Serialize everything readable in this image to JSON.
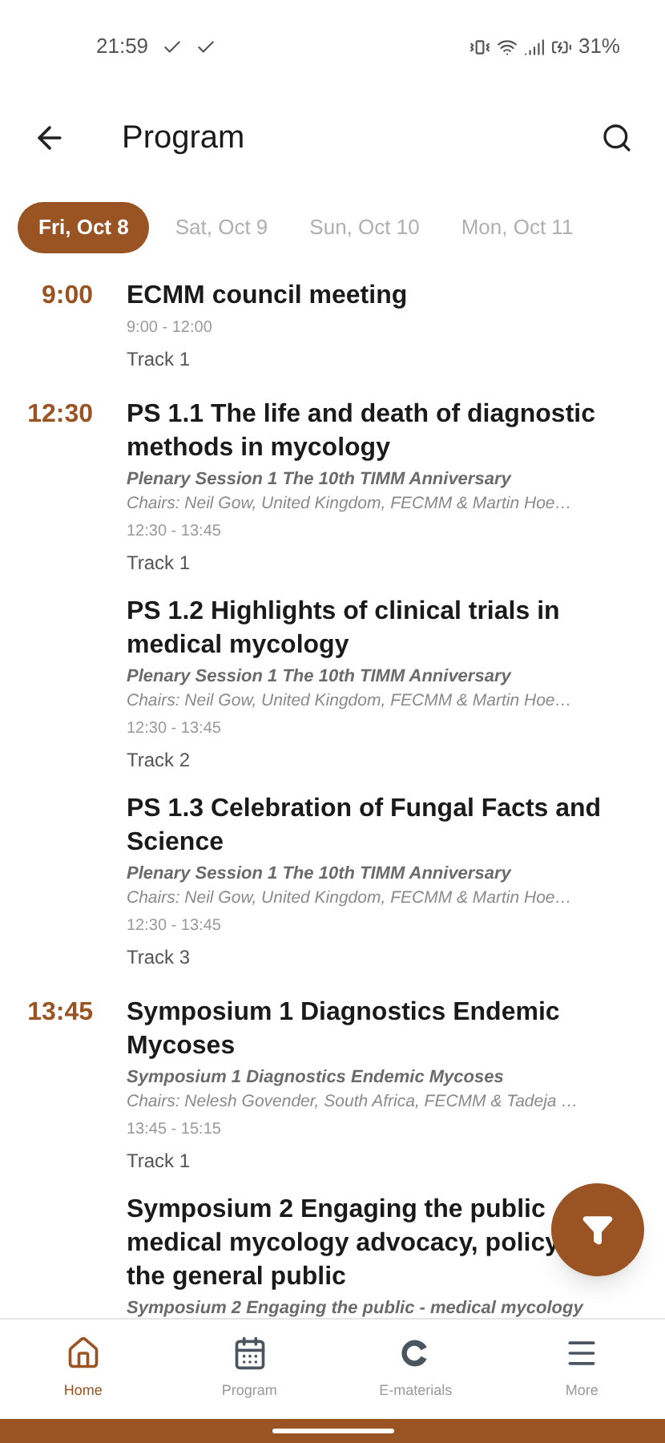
{
  "status_bar": {
    "time": "21:59",
    "battery": "31%"
  },
  "header": {
    "title": "Program"
  },
  "days": [
    {
      "label": "Fri, Oct 8",
      "selected": true
    },
    {
      "label": "Sat, Oct 9",
      "selected": false
    },
    {
      "label": "Sun, Oct 10",
      "selected": false
    },
    {
      "label": "Mon, Oct 11",
      "selected": false
    }
  ],
  "slots": [
    {
      "time": "9:00",
      "sessions": [
        {
          "title_lines": [
            "ECMM council meeting"
          ],
          "hours": "9:00 - 12:00",
          "track": "Track 1"
        }
      ]
    },
    {
      "time": "12:30",
      "sessions": [
        {
          "title_lines": [
            "PS 1.1 The life and death of diagnostic methods in mycology"
          ],
          "subtitle": "Plenary Session 1 The 10th TIMM Anniversary",
          "chairs": "Chairs: Neil Gow, United Kingdom, FECMM & Martin Hoe…",
          "hours": "12:30 - 13:45",
          "track": "Track 1"
        },
        {
          "title_lines": [
            "PS 1.2 Highlights of clinical trials in medical mycology"
          ],
          "subtitle": "Plenary Session 1 The 10th TIMM Anniversary",
          "chairs": "Chairs: Neil Gow, United Kingdom, FECMM & Martin Hoe…",
          "hours": "12:30 - 13:45",
          "track": "Track 2"
        },
        {
          "title_lines": [
            "PS 1.3 Celebration of Fungal Facts and Science"
          ],
          "subtitle": "Plenary Session 1 The 10th TIMM Anniversary",
          "chairs": "Chairs: Neil Gow, United Kingdom, FECMM & Martin Hoe…",
          "hours": "12:30 - 13:45",
          "track": "Track 3"
        }
      ]
    },
    {
      "time": "13:45",
      "sessions": [
        {
          "title_lines": [
            "Symposium 1 Diagnostics Endemic Mycoses"
          ],
          "subtitle": "Symposium 1 Diagnostics Endemic Mycoses",
          "chairs": "Chairs: Nelesh Govender, South Africa, FECMM & Tadeja …",
          "hours": "13:45 - 15:15",
          "track": "Track 1"
        },
        {
          "title_lines": [
            "Symposium 2 Engaging the public",
            "medical mycology advocacy, policy",
            "the general public"
          ],
          "subtitle": "Symposium 2 Engaging the public - medical mycology"
        }
      ]
    }
  ],
  "nav": [
    {
      "label": "Home",
      "selected": true
    },
    {
      "label": "Program",
      "selected": false
    },
    {
      "label": "E-materials",
      "selected": false
    },
    {
      "label": "More",
      "selected": false
    }
  ]
}
